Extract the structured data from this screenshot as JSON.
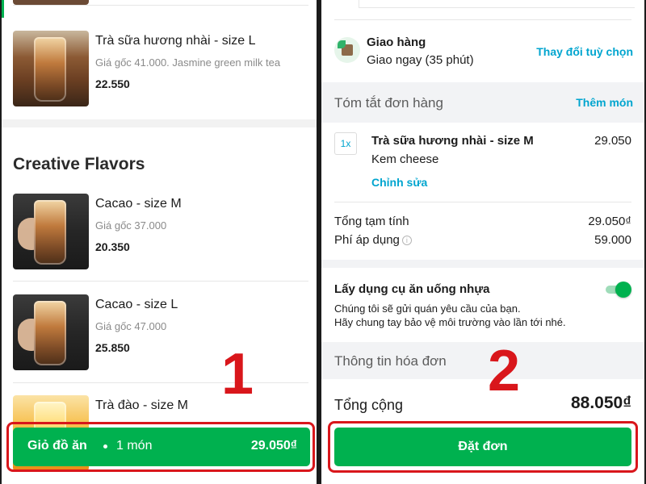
{
  "left": {
    "top_item": {
      "name": "Trà sữa hương nhài - size L",
      "desc": "Giá gốc 41.000. Jasmine green milk tea",
      "price": "22.550"
    },
    "section_title": "Creative Flavors",
    "items": [
      {
        "name": "Cacao - size M",
        "desc": "Giá gốc 37.000",
        "price": "20.350"
      },
      {
        "name": "Cacao - size L",
        "desc": "Giá gốc 47.000",
        "price": "25.850"
      },
      {
        "name": "Trà đào - size M"
      }
    ],
    "cart": {
      "label": "Giỏ đồ ăn",
      "count": "1 món",
      "total": "29.050₫"
    },
    "marker_number": "1"
  },
  "right": {
    "delivery": {
      "title": "Giao hàng",
      "subtitle": "Giao ngay (35 phút)",
      "change_link": "Thay đổi tuỳ chọn"
    },
    "summary": {
      "title": "Tóm tắt đơn hàng",
      "add_link": "Thêm món",
      "order_item": {
        "qty": "1x",
        "name": "Trà sữa hương nhài - size M",
        "price": "29.050",
        "option": "Kem cheese",
        "edit_link": "Chỉnh sửa"
      },
      "subtotal_label": "Tổng tạm tính",
      "subtotal_value": "29.050₫",
      "fee_label": "Phí áp dụng",
      "fee_value": "59.000"
    },
    "utensils": {
      "title": "Lấy dụng cụ ăn uống nhựa",
      "line1": "Chúng tôi sẽ gửi quán yêu cầu của bạn.",
      "line2": "Hãy chung tay bảo vệ môi trường vào lần tới nhé.",
      "toggle_on": true
    },
    "invoice_title": "Thông tin hóa đơn",
    "total_label": "Tổng cộng",
    "total_value": "88.050₫",
    "order_button": "Đặt đơn",
    "marker_number": "2"
  },
  "colors": {
    "brand_green": "#00b14f",
    "link_blue": "#00a5cf",
    "marker_red": "#d9161b"
  }
}
